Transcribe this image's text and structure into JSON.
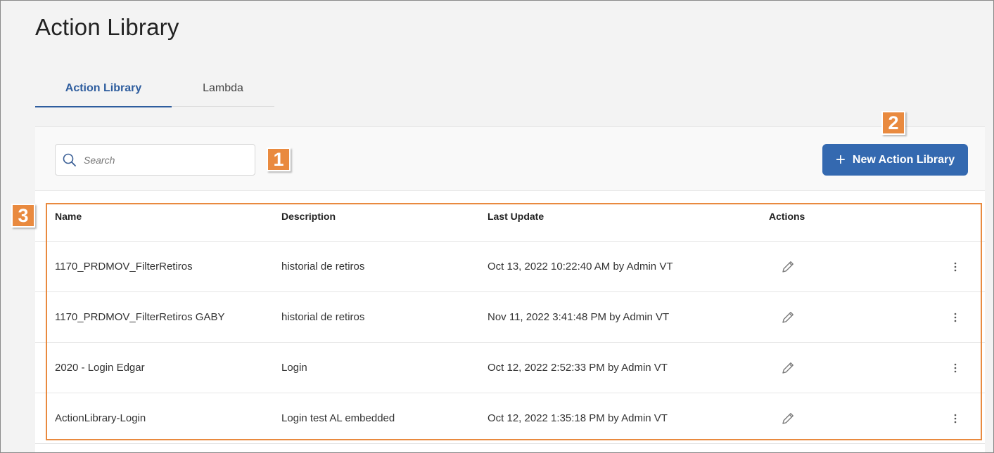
{
  "page": {
    "title": "Action Library"
  },
  "tabs": [
    {
      "label": "Action Library",
      "active": true
    },
    {
      "label": "Lambda",
      "active": false
    }
  ],
  "search": {
    "placeholder": "Search",
    "value": ""
  },
  "toolbar": {
    "new_button_label": "New Action Library",
    "new_button_icon": "plus-icon"
  },
  "markers": [
    "1",
    "2",
    "3"
  ],
  "table": {
    "headers": {
      "name": "Name",
      "description": "Description",
      "last_update": "Last Update",
      "actions": "Actions"
    },
    "rows": [
      {
        "name": "1170_PRDMOV_FilterRetiros",
        "description": "historial de retiros",
        "last_update": "Oct 13, 2022 10:22:40 AM by Admin VT"
      },
      {
        "name": "1170_PRDMOV_FilterRetiros GABY",
        "description": "historial de retiros",
        "last_update": "Nov 11, 2022 3:41:48 PM by Admin VT"
      },
      {
        "name": "2020 - Login Edgar",
        "description": "Login",
        "last_update": "Oct 12, 2022 2:52:33 PM by Admin VT"
      },
      {
        "name": "ActionLibrary-Login",
        "description": "Login test AL embedded",
        "last_update": "Oct 12, 2022 1:35:18 PM by Admin VT"
      }
    ]
  },
  "colors": {
    "accent": "#3469b0",
    "tab_active": "#2e5d9e",
    "annotation": "#e98a3f"
  }
}
